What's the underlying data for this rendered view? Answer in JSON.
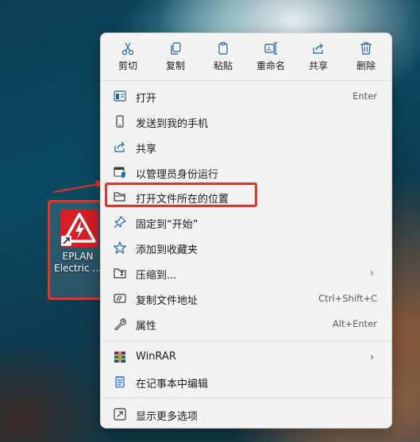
{
  "desktop_icon": {
    "label_line1": "EPLAN",
    "label_line2": "Electric ..."
  },
  "toolbar": [
    {
      "name": "cut",
      "label": "剪切"
    },
    {
      "name": "copy",
      "label": "复制"
    },
    {
      "name": "paste",
      "label": "粘贴"
    },
    {
      "name": "rename",
      "label": "重命名"
    },
    {
      "name": "share",
      "label": "共享"
    },
    {
      "name": "delete",
      "label": "删除"
    }
  ],
  "menu": {
    "open": {
      "label": "打开",
      "shortcut": "Enter"
    },
    "send_to_phone": {
      "label": "发送到我的手机"
    },
    "share": {
      "label": "共享"
    },
    "run_as_admin": {
      "label": "以管理员身份运行"
    },
    "open_file_location": {
      "label": "打开文件所在的位置"
    },
    "pin_to_start": {
      "label": "固定到“开始”"
    },
    "add_to_favorites": {
      "label": "添加到收藏夹"
    },
    "compress_to": {
      "label": "压缩到..."
    },
    "copy_path": {
      "label": "复制文件地址",
      "shortcut": "Ctrl+Shift+C"
    },
    "properties": {
      "label": "属性",
      "shortcut": "Alt+Enter"
    },
    "winrar": {
      "label": "WinRAR"
    },
    "edit_notepad": {
      "label": "在记事本中编辑"
    },
    "show_more": {
      "label": "显示更多选项"
    }
  },
  "colors": {
    "highlight": "#e53328",
    "accent": "#0067c0"
  }
}
